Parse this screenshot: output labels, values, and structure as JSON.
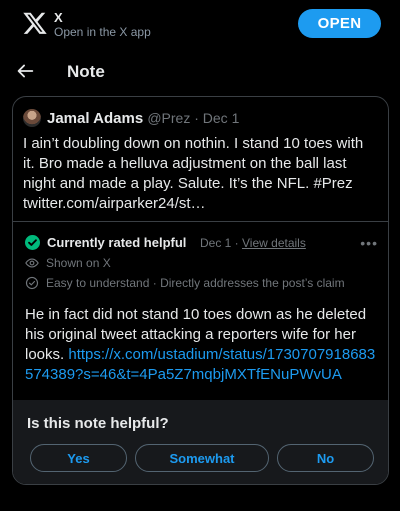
{
  "banner": {
    "title": "X",
    "subtitle": "Open in the X app",
    "open_label": "OPEN"
  },
  "header": {
    "title": "Note"
  },
  "tweet": {
    "author_name": "Jamal Adams",
    "handle_date": "@Prez · Dec 1",
    "text": "I ain’t doubling down on nothin. I stand 10 toes with it. Bro made a helluva adjustment on the ball last night and made a play. Salute. It’s the NFL. #Prez twitter.com/airparker24/st…"
  },
  "note": {
    "status": "Currently rated helpful",
    "date": "Dec 1 · ",
    "view_details": "View details",
    "more": "•••",
    "shown_on": "Shown on X",
    "tags": "Easy to understand · Directly addresses the post’s claim",
    "text": "He in fact did not stand 10 toes down as he deleted his original tweet attacking a reporters wife for her looks. ",
    "link": "https://x.com/ustadium/status/1730707918683574389?s=46&t=4Pa5Z7mqbjMXTfENuPWvUA"
  },
  "helpful": {
    "question": "Is this note helpful?",
    "yes": "Yes",
    "somewhat": "Somewhat",
    "no": "No"
  },
  "colors": {
    "accent": "#1d9bf0",
    "rated_helpful": "#00ba7c"
  }
}
